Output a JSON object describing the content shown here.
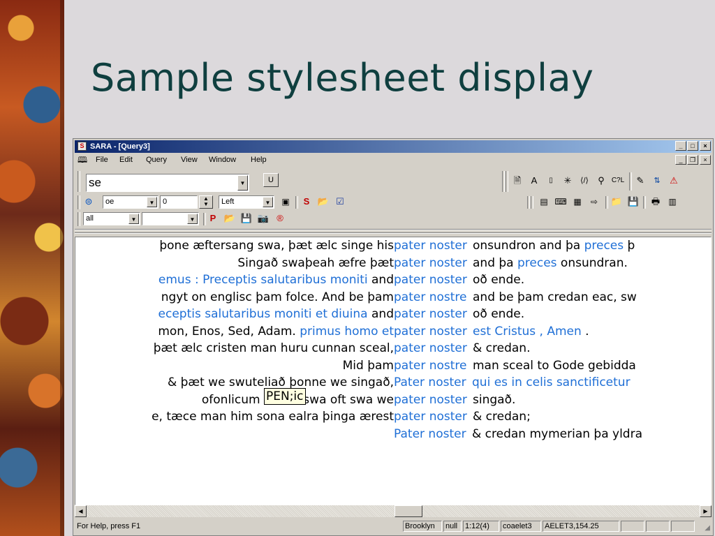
{
  "slide": {
    "title": "Sample stylesheet display"
  },
  "window": {
    "title": "SARA - [Query3]",
    "controls": {
      "minimize": "_",
      "maximize": "□",
      "close": "×"
    }
  },
  "menu": {
    "items": [
      "File",
      "Edit",
      "Query",
      "View",
      "Window",
      "Help"
    ],
    "mdi": {
      "minimize": "_",
      "restore": "❐",
      "close": "×"
    }
  },
  "toolbar1": {
    "query_value": "se",
    "u_button": "U"
  },
  "toolbar2": {
    "codeset_value": "oe",
    "number_value": "0",
    "align_value": "Left"
  },
  "toolbar3": {
    "scope_value": "all",
    "empty_value": ""
  },
  "concordance": {
    "rows": [
      {
        "left": "þone æftersang swa, þæt ælc singe his",
        "keyword": "pater noster",
        "right": [
          {
            "t": "onsundron and þa ",
            "blue": false
          },
          {
            "t": "preces",
            "blue": true
          },
          {
            "t": " þ",
            "blue": false
          }
        ]
      },
      {
        "left": "Singað swaþeah æfre þæt",
        "keyword": "pater noster",
        "right": [
          {
            "t": "and þa ",
            "blue": false
          },
          {
            "t": "preces",
            "blue": true
          },
          {
            "t": " onsundran.",
            "blue": false
          }
        ]
      },
      {
        "left": "emus : Preceptis salutaribus moniti",
        "left_blue": "emus : Preceptis salutaribus moniti",
        "left_rest": " and",
        "keyword": "pater noster",
        "right": [
          {
            "t": "oð ende.",
            "blue": false
          }
        ]
      },
      {
        "left": "ngyt on englisc þam folce. And be þam",
        "keyword": "pater nostre",
        "right": [
          {
            "t": "and be þam credan eac, sw",
            "blue": false
          }
        ]
      },
      {
        "left_blue": "eceptis salutaribus moniti et diuina",
        "left_rest": " and",
        "keyword": "pater noster",
        "right": [
          {
            "t": "oð ende.",
            "blue": false
          }
        ]
      },
      {
        "left_plain": "mon, Enos, Sed, Adam. ",
        "left_blue": "primus homo et",
        "keyword": "pater noster",
        "right": [
          {
            "t": "est Cristus , Amen",
            "blue": true
          },
          {
            "t": " .",
            "blue": false
          }
        ]
      },
      {
        "left": "þæt ælc cristen man huru cunnan sceal,",
        "keyword": "pater noster",
        "right": [
          {
            "t": "& credan.",
            "blue": false
          }
        ]
      },
      {
        "left": "Mid þam",
        "keyword": "pater nostre",
        "right": [
          {
            "t": "man sceal to Gode gebidda",
            "blue": false
          }
        ]
      },
      {
        "left": "& þæt we swuteliað þonne we singað,",
        "keyword": "Pater noster",
        "right": [
          {
            "t": "qui es in celis sanctificetur",
            "blue": true
          }
        ]
      },
      {
        "left": "ofonlicum fæder swa oft swa we",
        "keyword": "pater noster",
        "right": [
          {
            "t": "singað.",
            "blue": false
          }
        ]
      },
      {
        "left": "e, tæce man him sona ealra þinga ærest",
        "keyword": "pater noster",
        "right": [
          {
            "t": "& credan;",
            "blue": false
          }
        ]
      },
      {
        "left": "",
        "keyword": "Pater noster",
        "right": [
          {
            "t": "& credan mymerian þa yldra",
            "blue": false
          }
        ]
      }
    ],
    "tooltip": "PEN;ic"
  },
  "status": {
    "help": "For Help, press F1",
    "font": "Brooklyn",
    "null": "null",
    "position": "1:12(4)",
    "corpus": "coaelet3",
    "ref": "AELET3,154.25"
  }
}
